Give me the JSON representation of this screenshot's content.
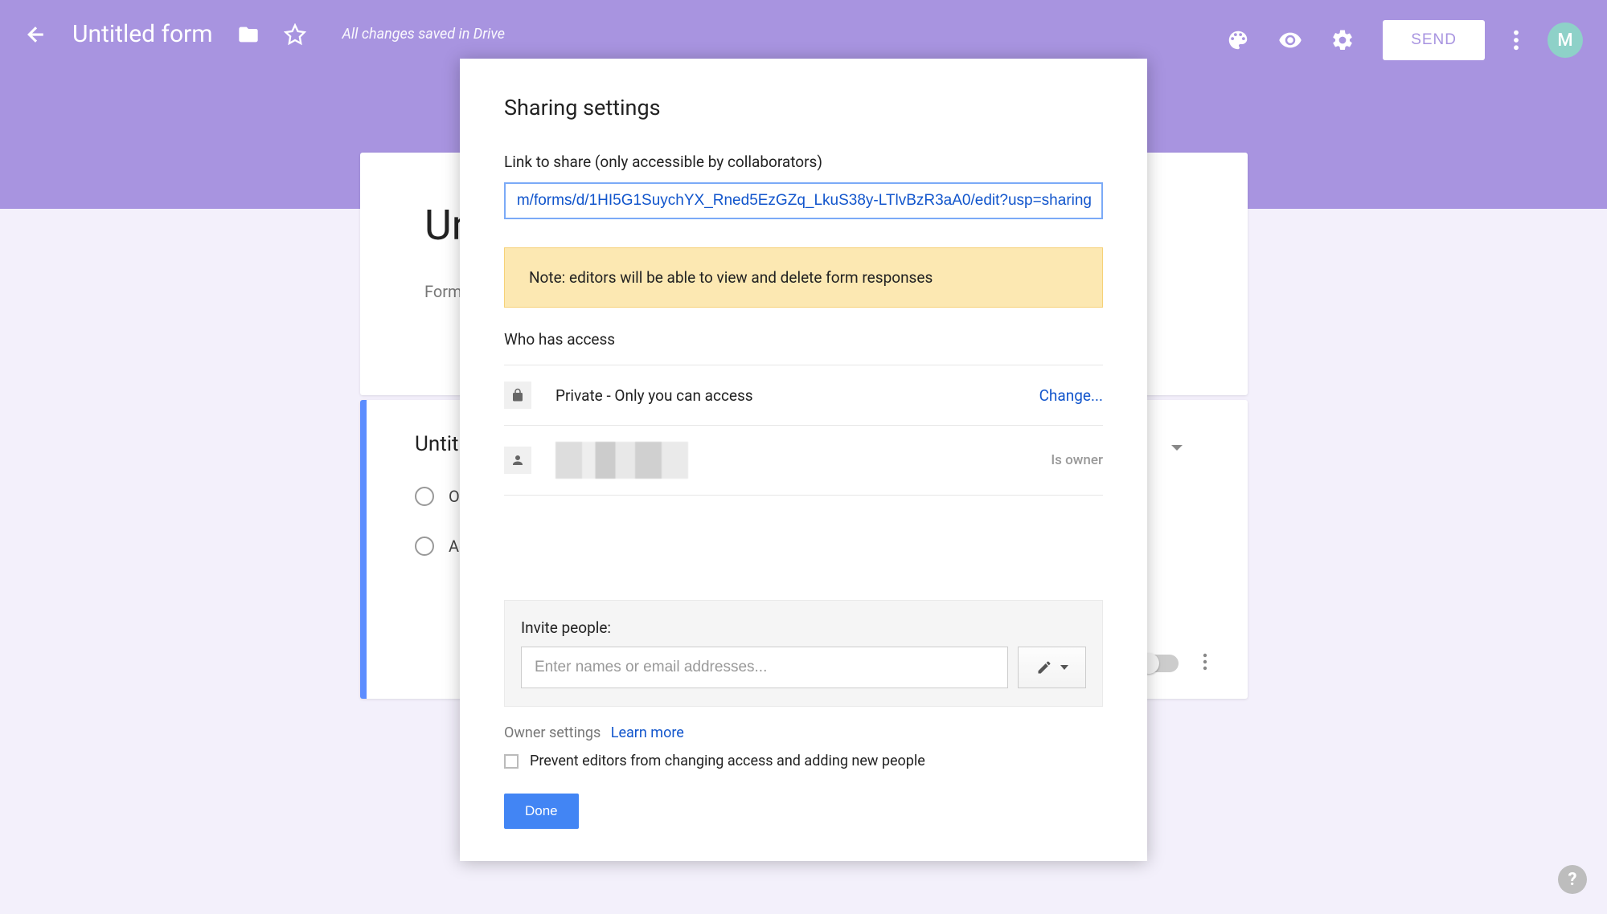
{
  "header": {
    "title": "Untitled form",
    "save_status": "All changes saved in Drive",
    "send_label": "SEND",
    "avatar_initial": "M"
  },
  "form": {
    "title_display": "Unt",
    "description_display": "Form de",
    "question_title": "Untitl",
    "option1": "Op",
    "add_option": "Ad"
  },
  "dialog": {
    "title": "Sharing settings",
    "link_label": "Link to share (only accessible by collaborators)",
    "link_value": "m/forms/d/1HI5G1SuychYX_Rned5EzGZq_LkuS38y-LTlvBzR3aA0/edit?usp=sharing",
    "note": "Note: editors will be able to view and delete form responses",
    "who_has_access": "Who has access",
    "access": {
      "privacy_text": "Private - Only you can access",
      "change_label": "Change...",
      "owner_label": "Is owner"
    },
    "invite": {
      "label": "Invite people:",
      "placeholder": "Enter names or email addresses..."
    },
    "owner_settings_label": "Owner settings",
    "learn_more": "Learn more",
    "prevent_editors": "Prevent editors from changing access and adding new people",
    "done_label": "Done"
  },
  "help_label": "?"
}
